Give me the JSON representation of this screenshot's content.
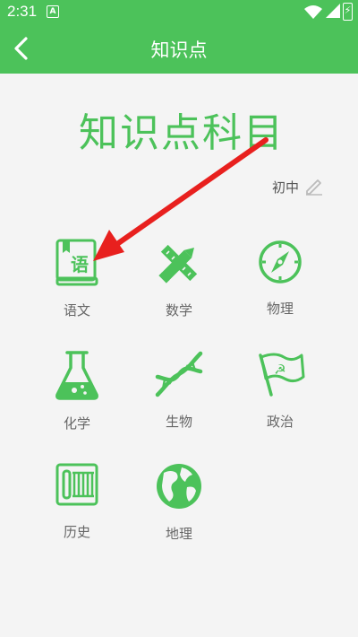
{
  "status_bar": {
    "time": "2:31",
    "notification_icon": "A"
  },
  "app_bar": {
    "back_icon": "chevron-left",
    "title": "知识点"
  },
  "heading": "知识点科目",
  "level": {
    "value": "初中",
    "edit_icon": "pencil"
  },
  "subjects": [
    {
      "label": "语文",
      "icon": "book-icon"
    },
    {
      "label": "数学",
      "icon": "ruler-pencil-icon"
    },
    {
      "label": "物理",
      "icon": "compass-icon"
    },
    {
      "label": "化学",
      "icon": "flask-icon"
    },
    {
      "label": "生物",
      "icon": "dna-icon"
    },
    {
      "label": "政治",
      "icon": "flag-icon"
    },
    {
      "label": "历史",
      "icon": "scroll-icon"
    },
    {
      "label": "地理",
      "icon": "globe-icon"
    }
  ],
  "colors": {
    "accent": "#4cc25a",
    "annotation_arrow": "#e8201e"
  }
}
